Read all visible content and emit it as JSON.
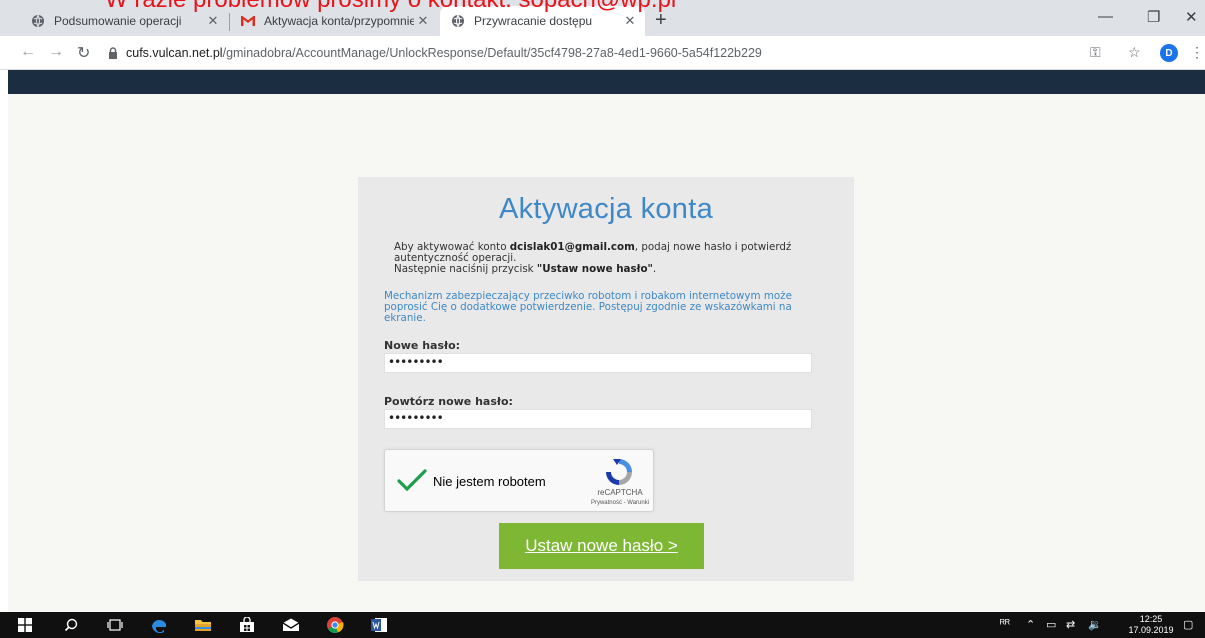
{
  "overlay_note": "W razie problemów prosimy o kontakt: sopach@wp.pl",
  "browser": {
    "tabs": [
      {
        "title": "Podsumowanie operacji",
        "icon": "globe-icon",
        "active": false
      },
      {
        "title": "Aktywacja konta/przypomnienie ",
        "icon": "gmail-icon",
        "active": false
      },
      {
        "title": "Przywracanie dostępu",
        "icon": "globe-icon",
        "active": true
      }
    ],
    "tab_close": "✕",
    "new_tab": "+",
    "url_host": "cufs.vulcan.net.pl",
    "url_path": "/gminadobra/AccountManage/UnlockResponse/Default/35cf4798-27a8-4ed1-9660-5a54f122b229",
    "profile_initial": "D"
  },
  "card": {
    "title": "Aktywacja konta",
    "text_prefix": "Aby aktywować konto ",
    "email": "dcislak01@gmail.com",
    "text_middle": ", podaj nowe hasło i potwierdź autentyczność operacji.",
    "text_line2_prefix": "Następnie naciśnij przycisk ",
    "button_quote": "\"Ustaw nowe hasło\"",
    "text_line2_suffix": ".",
    "info": "Mechanizm zabezpieczający przeciwko robotom i robakom internetowym może poprosić Cię o dodatkowe potwierdzenie. Postępuj zgodnie ze wskazówkami na ekranie.",
    "new_password_label": "Nowe hasło:",
    "new_password_value": "•••••••••",
    "repeat_password_label": "Powtórz nowe hasło:",
    "repeat_password_value": "•••••••••",
    "captcha_label": "Nie jestem robotem",
    "captcha_brand": "reCAPTCHA",
    "captcha_links": "Prywatność - Warunki",
    "submit_label": "Ustaw nowe hasło >"
  },
  "taskbar": {
    "time": "12:25",
    "date": "17.09.2019"
  },
  "colors": {
    "header": "#1b2e41",
    "title_blue": "#3e88c7",
    "submit_green": "#7db734",
    "check_green": "#1e9e4a",
    "overlay_red": "#e8141c"
  }
}
